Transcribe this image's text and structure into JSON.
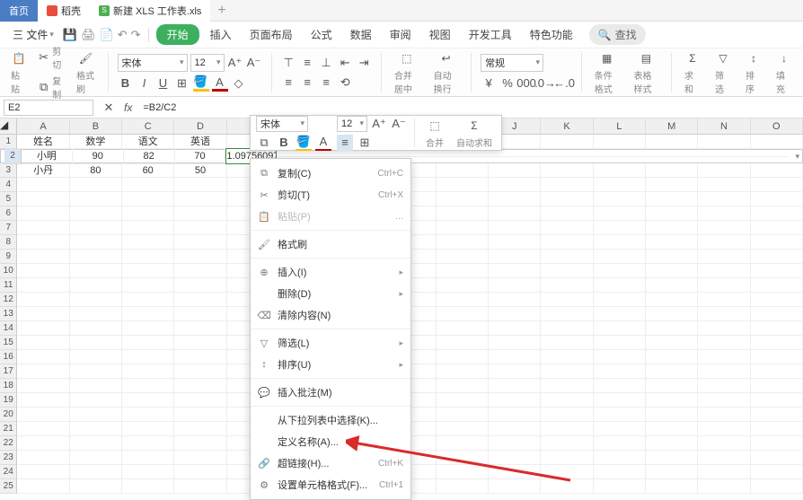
{
  "tabs": {
    "home": "首页",
    "dk": "稻壳",
    "xls": "新建 XLS 工作表.xls"
  },
  "menubar": {
    "file": "三 文件",
    "start": "开始",
    "insert": "插入",
    "page": "页面布局",
    "formula": "公式",
    "data": "数据",
    "review": "审阅",
    "view": "视图",
    "dev": "开发工具",
    "feature": "特色功能",
    "search": "查找"
  },
  "ribbon": {
    "cut": "剪切",
    "copy": "复制",
    "paste": "粘贴",
    "fmtpaint": "格式刷",
    "font": "宋体",
    "size": "12",
    "merge": "合并居中",
    "wrap": "自动换行",
    "numfmt": "常规",
    "condfmt": "条件格式",
    "cellstyle": "表格样式",
    "sum": "求和",
    "filter": "筛选",
    "sort": "排序",
    "fill": "填充"
  },
  "addr": {
    "name": "E2",
    "formula": "=B2/C2"
  },
  "cols": [
    "A",
    "B",
    "C",
    "D",
    "E",
    "F",
    "G",
    "H",
    "I",
    "J",
    "K",
    "L",
    "M",
    "N",
    "O"
  ],
  "data": {
    "r1": [
      "姓名",
      "数学",
      "语文",
      "英语",
      "",
      "",
      "",
      "",
      "",
      "",
      "",
      "",
      "",
      "",
      ""
    ],
    "r2": [
      "小明",
      "90",
      "82",
      "70",
      "1.097560976|",
      "",
      "",
      "",
      "",
      "",
      "",
      "",
      "",
      "",
      ""
    ],
    "r3": [
      "小丹",
      "80",
      "60",
      "50",
      "",
      "",
      "",
      "",
      "",
      "",
      "",
      "",
      "",
      "",
      ""
    ]
  },
  "rowcount": 25,
  "mini": {
    "font": "宋体",
    "size": "12",
    "merge": "合并",
    "sum": "自动求和"
  },
  "ctx": {
    "copy": "复制(C)",
    "copy_sc": "Ctrl+C",
    "cut": "剪切(T)",
    "cut_sc": "Ctrl+X",
    "paste": "粘贴(P)",
    "fmtpaint": "格式刷",
    "insert": "插入(I)",
    "delete": "删除(D)",
    "clear": "清除内容(N)",
    "filter": "筛选(L)",
    "sort": "排序(U)",
    "comment": "插入批注(M)",
    "dropdown": "从下拉列表中选择(K)...",
    "defname": "定义名称(A)...",
    "link": "超链接(H)...",
    "link_sc": "Ctrl+K",
    "cellfmt": "设置单元格格式(F)...",
    "cellfmt_sc": "Ctrl+1"
  }
}
